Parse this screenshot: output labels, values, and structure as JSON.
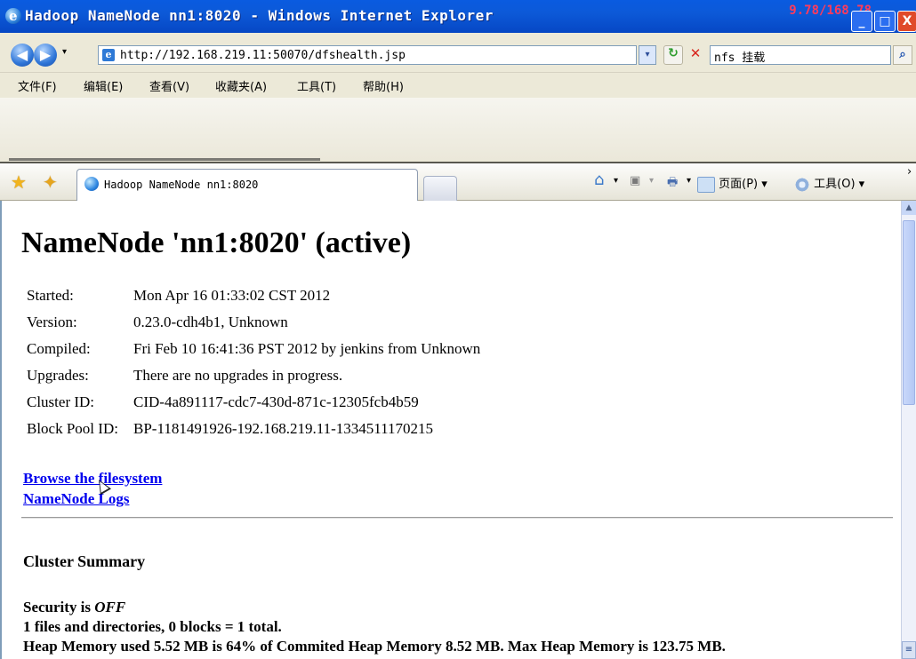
{
  "window": {
    "title": "Hadoop NameNode nn1:8020 - Windows Internet Explorer",
    "corner_text": "9.78/168.78",
    "min_label": "_",
    "max_label": "□",
    "close_label": "X"
  },
  "address": {
    "back_label": "◀",
    "forward_label": "▶",
    "history_dropdown": "▾",
    "url": "http://192.168.219.11:50070/dfshealth.jsp",
    "url_dropdown": "▾",
    "refresh_label": "↻",
    "stop_label": "✕",
    "search_value": "nfs 挂载",
    "search_button_label": "⌕"
  },
  "menu": [
    {
      "label": "文件(F)"
    },
    {
      "label": "编辑(E)"
    },
    {
      "label": "查看(V)"
    },
    {
      "label": "收藏夹(A)"
    },
    {
      "label": "工具(T)"
    },
    {
      "label": "帮助(H)"
    }
  ],
  "tabs": {
    "favorites_icon": "★",
    "add_favorites_icon": "✦",
    "active_tab": "Hadoop NameNode nn1:8020"
  },
  "command_bar": {
    "home_icon": "⌂",
    "feeds_icon": "▣",
    "print_icon": "🖶",
    "page_label": "页面(P)",
    "tools_label": "工具(O)",
    "more_label": "›"
  },
  "page": {
    "heading": "NameNode 'nn1:8020' (active)",
    "info": [
      {
        "key": "Started:",
        "value": "Mon Apr 16 01:33:02 CST 2012"
      },
      {
        "key": "Version:",
        "value": "0.23.0-cdh4b1, Unknown"
      },
      {
        "key": "Compiled:",
        "value": "Fri Feb 10 16:41:36 PST 2012 by jenkins from Unknown"
      },
      {
        "key": "Upgrades:",
        "value": "There are no upgrades in progress."
      },
      {
        "key": "Cluster ID:",
        "value": "CID-4a891117-cdc7-430d-871c-12305fcb4b59"
      },
      {
        "key": "Block Pool ID:",
        "value": "BP-1181491926-192.168.219.11-1334511170215"
      }
    ],
    "links": {
      "browse": "Browse the filesystem",
      "logs": "NameNode Logs"
    },
    "section_title": "Cluster Summary",
    "security_prefix": "Security is ",
    "security_value": "OFF",
    "files_line": "1 files and directories, 0 blocks = 1 total.",
    "heap_line": "Heap Memory used 5.52 MB is 64% of Commited Heap Memory 8.52 MB. Max Heap Memory is 123.75 MB."
  }
}
